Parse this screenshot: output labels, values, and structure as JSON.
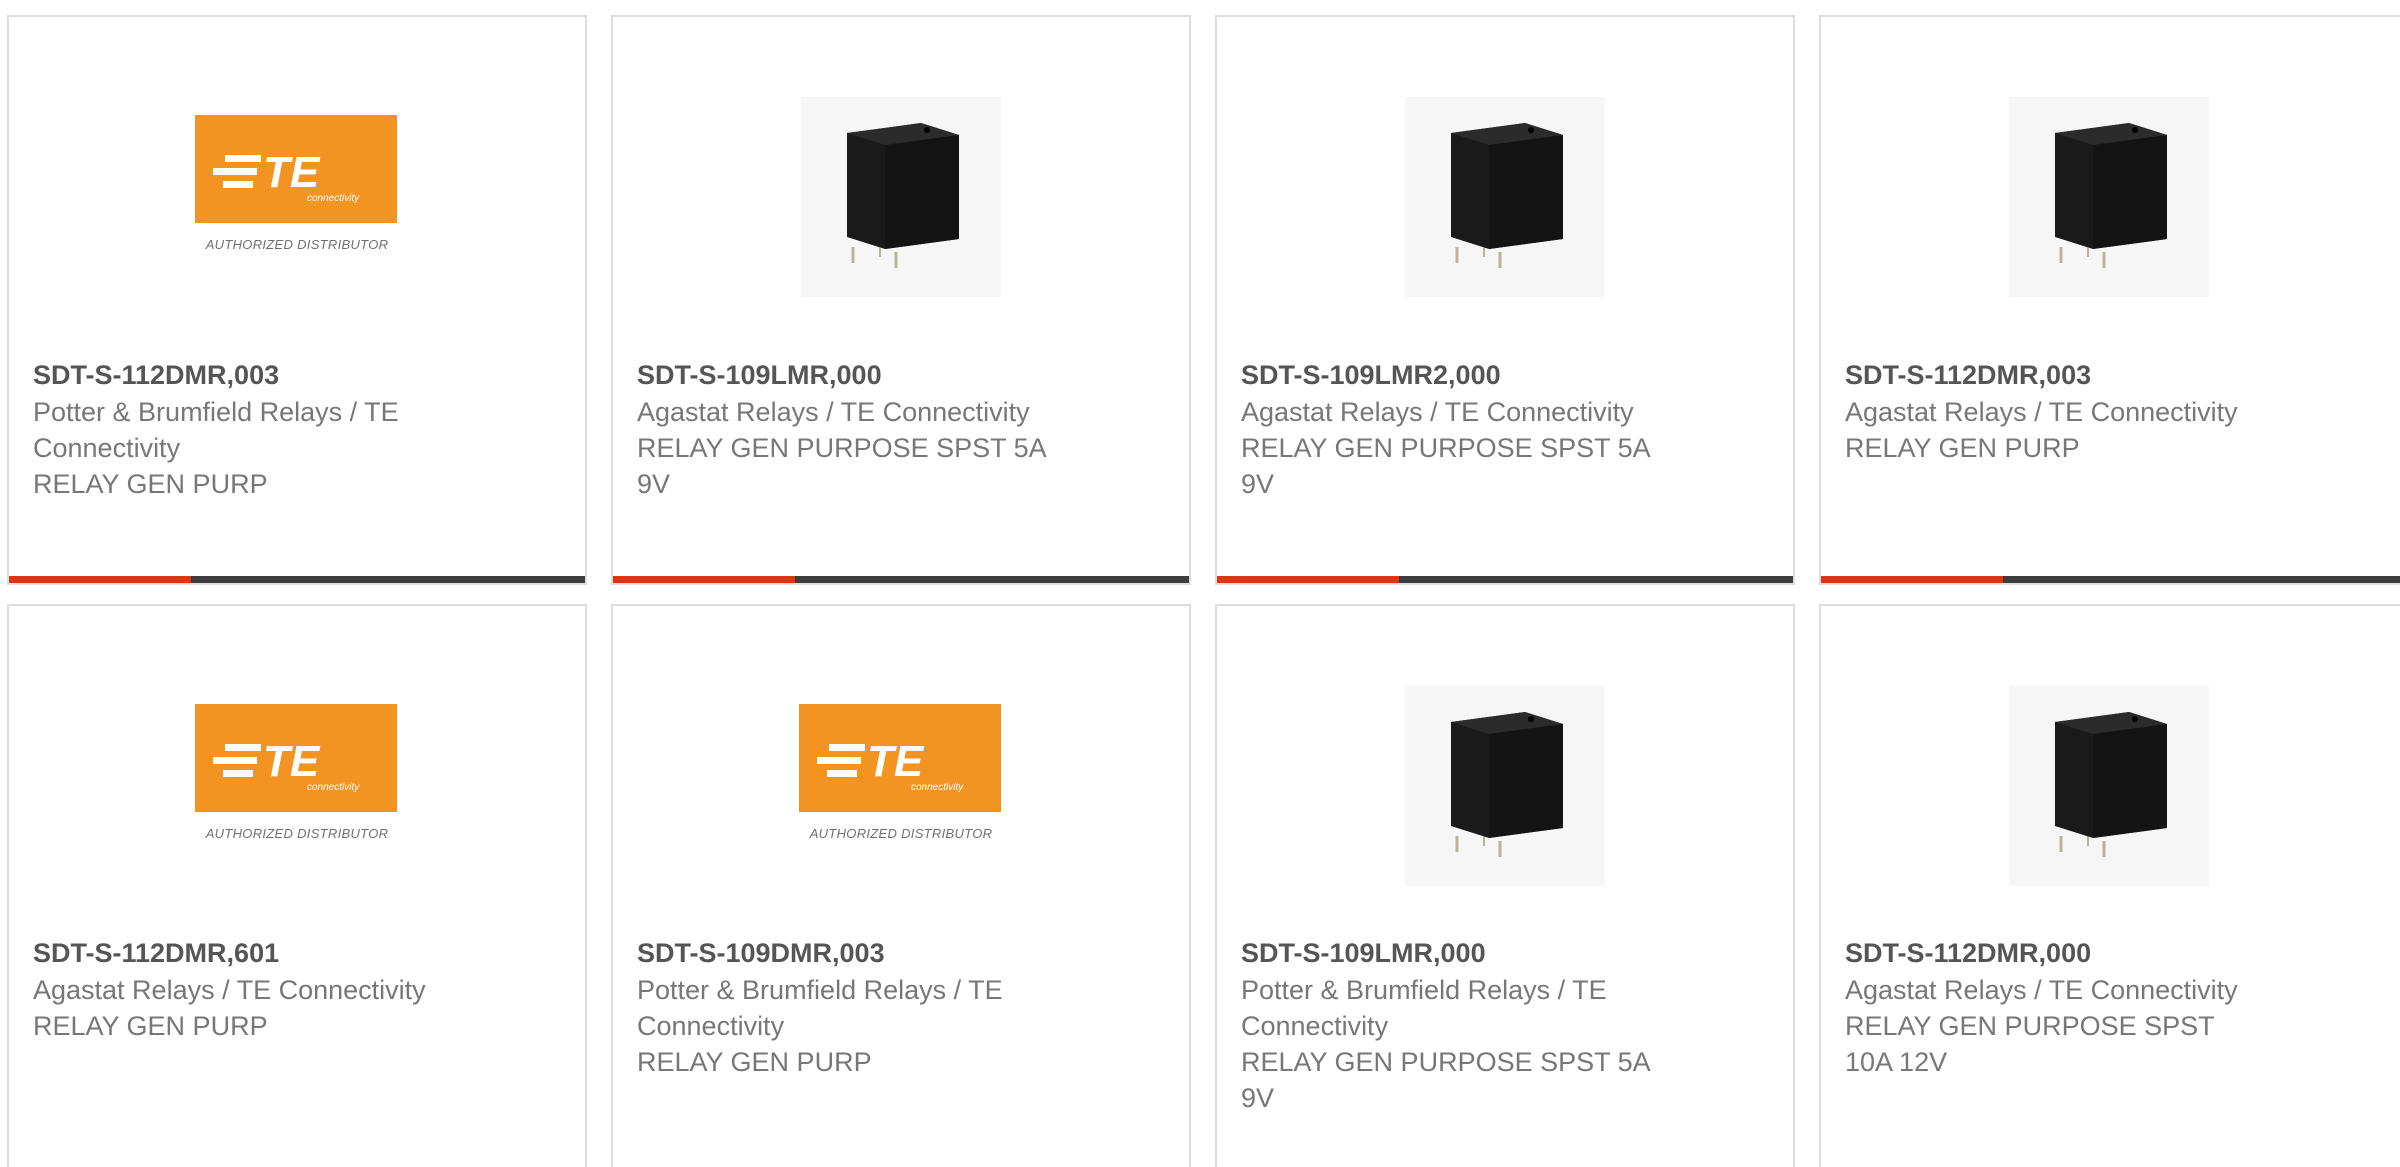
{
  "products": [
    {
      "part": "SDT-S-112DMR,003",
      "manufacturer_lines": [
        "Potter & Brumfield Relays / TE",
        "Connectivity"
      ],
      "description_lines": [
        "RELAY GEN PURP"
      ],
      "image": "te-logo",
      "logo_tagline": "AUTHORIZED DISTRIBUTOR"
    },
    {
      "part": "SDT-S-109LMR,000",
      "manufacturer_lines": [
        "Agastat Relays / TE Connectivity"
      ],
      "description_lines": [
        "RELAY GEN PURPOSE SPST 5A",
        "9V"
      ],
      "image": "relay-photo"
    },
    {
      "part": "SDT-S-109LMR2,000",
      "manufacturer_lines": [
        "Agastat Relays / TE Connectivity"
      ],
      "description_lines": [
        "RELAY GEN PURPOSE SPST 5A",
        "9V"
      ],
      "image": "relay-photo"
    },
    {
      "part": "SDT-S-112DMR,003",
      "manufacturer_lines": [
        "Agastat Relays / TE Connectivity"
      ],
      "description_lines": [
        "RELAY GEN PURP"
      ],
      "image": "relay-photo"
    },
    {
      "part": "SDT-S-112DMR,601",
      "manufacturer_lines": [
        "Agastat Relays / TE Connectivity"
      ],
      "description_lines": [
        "RELAY GEN PURP"
      ],
      "image": "te-logo",
      "logo_tagline": "AUTHORIZED DISTRIBUTOR"
    },
    {
      "part": "SDT-S-109DMR,003",
      "manufacturer_lines": [
        "Potter & Brumfield Relays / TE",
        "Connectivity"
      ],
      "description_lines": [
        "RELAY GEN PURP"
      ],
      "image": "te-logo",
      "logo_tagline": "AUTHORIZED DISTRIBUTOR"
    },
    {
      "part": "SDT-S-109LMR,000",
      "manufacturer_lines": [
        "Potter & Brumfield Relays / TE",
        "Connectivity"
      ],
      "description_lines": [
        "RELAY GEN PURPOSE SPST 5A",
        "9V"
      ],
      "image": "relay-photo"
    },
    {
      "part": "SDT-S-112DMR,000",
      "manufacturer_lines": [
        "Agastat Relays / TE Connectivity"
      ],
      "description_lines": [
        "RELAY GEN PURPOSE SPST",
        "10A 12V"
      ],
      "image": "relay-photo"
    }
  ],
  "colors": {
    "accent": "#e0330f",
    "bar": "#3d3d3d",
    "te_orange": "#f39322"
  }
}
